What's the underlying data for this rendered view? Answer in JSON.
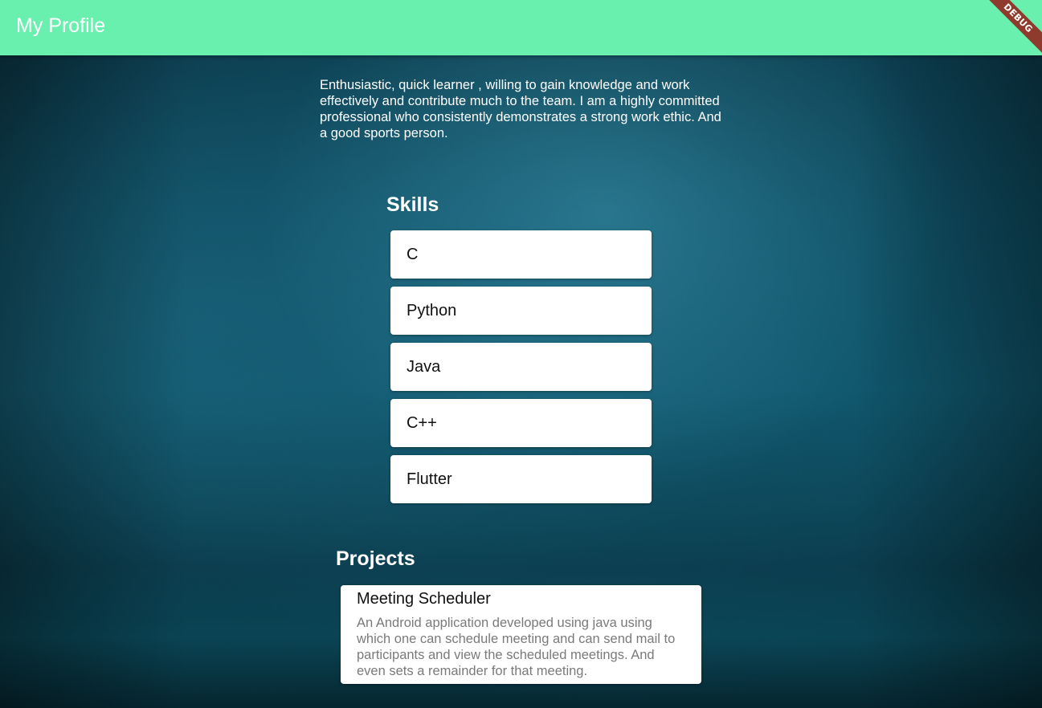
{
  "appbar": {
    "title": "My Profile",
    "color": "#69f0ae",
    "debug_label": "DEBUG"
  },
  "about": {
    "text": "Enthusiastic, quick learner , willing to gain knowledge and work effectively and contribute much to the team. I am a highly committed professional who consistently demonstrates a strong work ethic. And a good sports person."
  },
  "skills": {
    "title": "Skills",
    "items": [
      "C",
      "Python",
      "Java",
      "C++",
      "Flutter"
    ]
  },
  "projects": {
    "title": "Projects",
    "items": [
      {
        "name": "Meeting Scheduler",
        "description": "An Android application developed using java using which one can schedule meeting and can send mail to participants and view the scheduled meetings. And even sets a remainder for that meeting."
      }
    ]
  }
}
